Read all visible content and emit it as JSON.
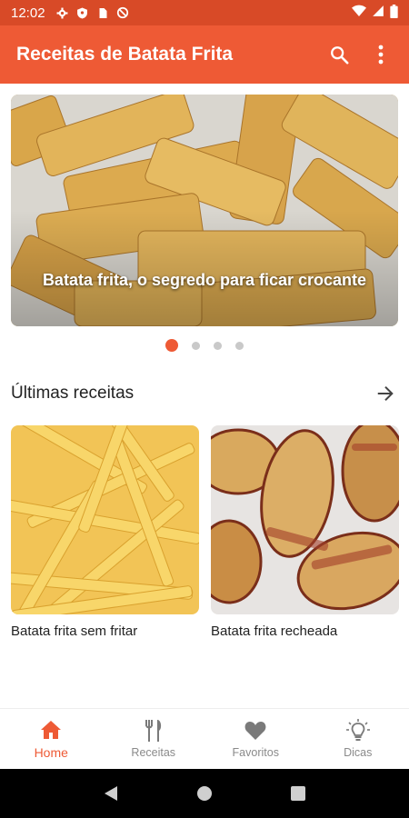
{
  "status_bar": {
    "time": "12:02",
    "icons": [
      "settings-icon",
      "shield-icon",
      "sim-icon",
      "no-disturb-icon"
    ],
    "right_icons": [
      "wifi-icon",
      "signal-icon",
      "battery-icon"
    ]
  },
  "app_bar": {
    "title": "Receitas de Batata Frita",
    "actions": [
      "search-icon",
      "more-vert-icon"
    ]
  },
  "carousel": {
    "slide_caption": "Batata frita, o segredo para ficar crocante",
    "slide_count": 4,
    "active_index": 0
  },
  "latest": {
    "title": "Últimas receitas",
    "see_all_icon": "arrow-right-icon",
    "items": [
      {
        "label": "Batata frita sem fritar"
      },
      {
        "label": "Batata frita recheada"
      }
    ]
  },
  "bottom_nav": {
    "items": [
      {
        "label": "Home",
        "icon": "home-icon",
        "active": true
      },
      {
        "label": "Receitas",
        "icon": "utensils-icon",
        "active": false
      },
      {
        "label": "Favoritos",
        "icon": "heart-icon",
        "active": false
      },
      {
        "label": "Dicas",
        "icon": "lightbulb-icon",
        "active": false
      }
    ]
  },
  "colors": {
    "status_bar": "#d84a27",
    "app_bar": "#ee5a35",
    "accent": "#ee5a35",
    "inactive": "#8a8a8a"
  }
}
